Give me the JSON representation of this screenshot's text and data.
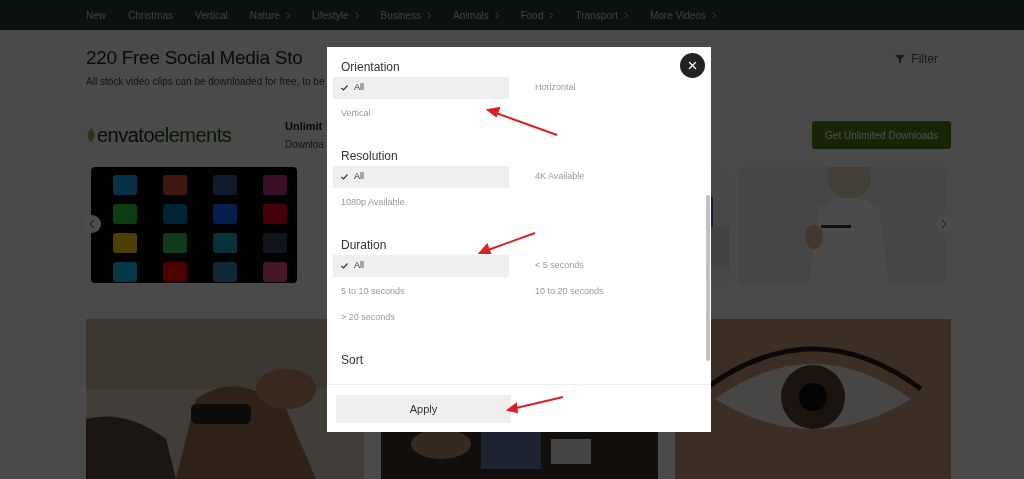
{
  "nav": [
    {
      "label": "New",
      "has_menu": false
    },
    {
      "label": "Christmas",
      "has_menu": false
    },
    {
      "label": "Vertical",
      "has_menu": false
    },
    {
      "label": "Nature",
      "has_menu": true
    },
    {
      "label": "Lifestyle",
      "has_menu": true
    },
    {
      "label": "Business",
      "has_menu": true
    },
    {
      "label": "Animals",
      "has_menu": true
    },
    {
      "label": "Food",
      "has_menu": true
    },
    {
      "label": "Transport",
      "has_menu": true
    },
    {
      "label": "More Videos",
      "has_menu": true
    }
  ],
  "heading": "220 Free Social Media Sto",
  "subtitle": "All stock video clips can be downloaded for free, to be",
  "filter": "Filter",
  "promo": {
    "logo_word": "envato",
    "logo_suffix": "elements",
    "title": "Unlimit",
    "text": "Downloa",
    "button": "Get Unlimited Downloads"
  },
  "modal": {
    "close": "×",
    "sections": [
      {
        "title": "Orientation",
        "options": [
          {
            "label": "All",
            "selected": true
          },
          {
            "label": "Horizontal",
            "selected": false
          },
          {
            "label": "Vertical",
            "selected": false
          }
        ]
      },
      {
        "title": "Resolution",
        "options": [
          {
            "label": "All",
            "selected": true
          },
          {
            "label": "4K Available",
            "selected": false
          },
          {
            "label": "1080p Available",
            "selected": false
          }
        ]
      },
      {
        "title": "Duration",
        "options": [
          {
            "label": "All",
            "selected": true
          },
          {
            "label": "< 5 seconds",
            "selected": false
          },
          {
            "label": "5 to 10 seconds",
            "selected": false
          },
          {
            "label": "10 to 20 seconds",
            "selected": false
          },
          {
            "label": "> 20 seconds",
            "selected": false
          }
        ]
      },
      {
        "title": "Sort"
      }
    ],
    "apply": "Apply"
  }
}
